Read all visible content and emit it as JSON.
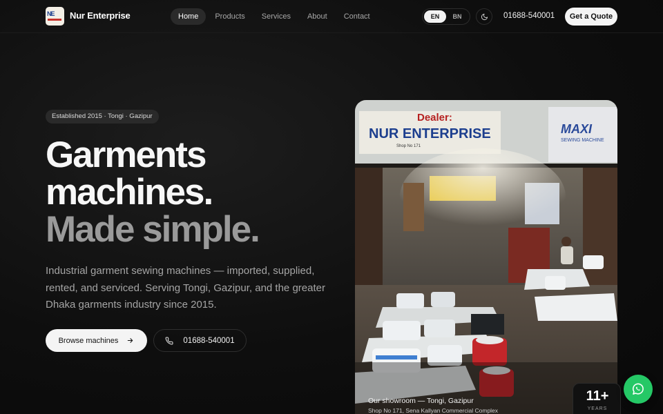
{
  "header": {
    "brand_name": "Nur Enterprise",
    "nav": [
      {
        "label": "Home",
        "active": true
      },
      {
        "label": "Products",
        "active": false
      },
      {
        "label": "Services",
        "active": false
      },
      {
        "label": "About",
        "active": false
      },
      {
        "label": "Contact",
        "active": false
      }
    ],
    "lang_en": "EN",
    "lang_bn": "BN",
    "lang_selected": "EN",
    "theme_icon": "moon-icon",
    "phone": "01688-540001",
    "quote_label": "Get a Quote"
  },
  "hero": {
    "badge": "Established 2015 · Tongi · Gazipur",
    "title_line1": "Garments",
    "title_line2": "machines.",
    "title_line3": "Made simple.",
    "subtitle": "Industrial garment sewing machines — imported, supplied, rented, and serviced. Serving Tongi, Gazipur, and the greater Dhaka garments industry since 2015.",
    "browse_label": "Browse machines",
    "browse_icon": "arrow-right-icon",
    "call_label": "01688-540001",
    "call_icon": "phone-icon"
  },
  "showroom": {
    "sign_dealer": "Dealer:",
    "sign_name": "NUR ENTERPRISE",
    "sign_shop": "Shop No 171",
    "sign_brand": "MAXI",
    "sign_brand_sub": "SEWING MACHINE",
    "caption_title": "Our showroom — Tongi, Gazipur",
    "caption_address": "Shop No 171, Sena Kallyan Commercial Complex",
    "years_value": "11+",
    "years_label": "YEARS"
  },
  "whatsapp_icon": "whatsapp-icon",
  "colors": {
    "background": "#0b0b0b",
    "accent_whatsapp": "#25c866",
    "title_muted": "#9a9a9a"
  }
}
